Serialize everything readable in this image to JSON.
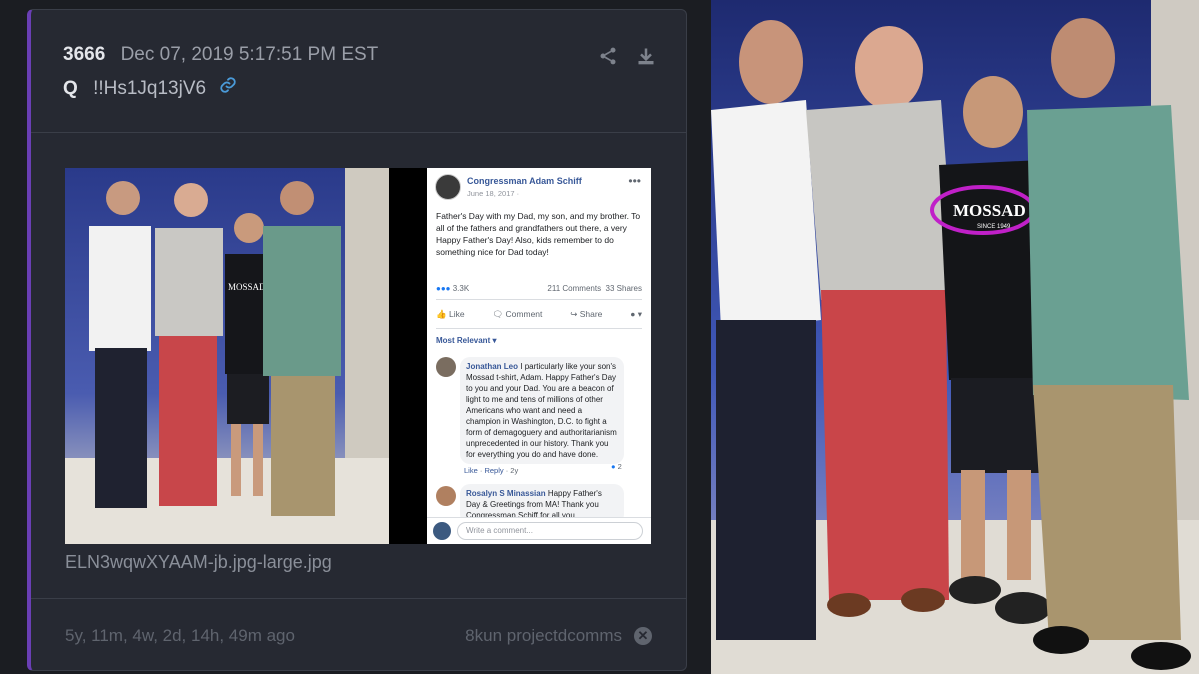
{
  "post": {
    "number": "3666",
    "date": "Dec 07, 2019 5:17:51 PM EST",
    "author": "Q",
    "tripcode": "!!Hs1Jq13jV6",
    "filename": "ELN3wqwXYAAM-jb.jpg-large.jpg",
    "age": "5y, 11m, 4w, 2d, 14h, 49m ago",
    "source": "8kun projectdcomms",
    "icons": [
      "share-icon",
      "download-icon",
      "link-icon",
      "close-icon"
    ],
    "accent_color": "#6a3fb5"
  },
  "facebook": {
    "page_name": "Congressman Adam Schiff",
    "post_date": "June 18, 2017 · ",
    "body": "Father's Day with my Dad, my son, and my brother. To all of the fathers and grandfathers out there, a very Happy Father's Day! Also, kids remember to do something nice for Dad today!",
    "reactions": "3.3K",
    "comments": "211 Comments",
    "shares": "33 Shares",
    "like_label": "Like",
    "comment_label": "Comment",
    "share_label": "Share",
    "sort_label": "Most Relevant ▾",
    "comment1_author": "Jonathan Leo",
    "comment1_text": "I particularly like your son's Mossad t-shirt, Adam. Happy Father's Day to you and your Dad. You are a beacon of light to me and tens of millions of other Americans who want and need a champion in Washington, D.C. to fight a form of demagoguery and authoritarianism unprecedented in our history. Thank you for everything you do and have done.",
    "comment1_like": "Like",
    "comment1_reply": "Reply",
    "comment1_age": "2y",
    "comment1_likes": "2",
    "comment2_author": "Rosalyn S Minassian",
    "comment2_text": "Happy Father's Day & Greetings from MA! Thank you Congressman Schiff for all you",
    "write_placeholder": "Write a comment..."
  },
  "photo": {
    "shirt_text": "MOSSAD",
    "shirt_subtext": "SINCE 1949",
    "highlight_color": "#c020c8"
  }
}
